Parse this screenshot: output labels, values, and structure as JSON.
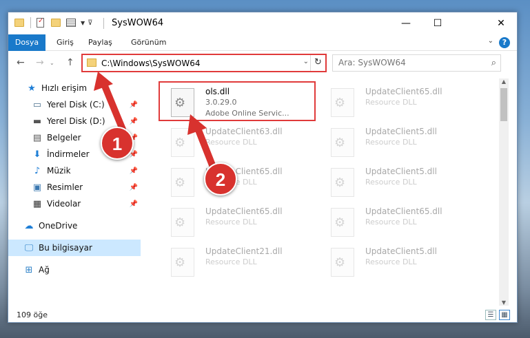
{
  "window": {
    "title": "SysWOW64",
    "controls": {
      "minimize": "—",
      "maximize": "☐",
      "close": "✕"
    }
  },
  "ribbon": {
    "tabs": [
      {
        "label": "Dosya"
      },
      {
        "label": "Giriş"
      },
      {
        "label": "Paylaş"
      },
      {
        "label": "Görünüm"
      }
    ],
    "help": "?"
  },
  "navigation": {
    "back": "←",
    "forward": "→",
    "up": "↑",
    "address": "C:\\Windows\\SysWOW64",
    "search_placeholder": "Ara: SysWOW64"
  },
  "sidebar": {
    "items": [
      {
        "label": "Hızlı erişim",
        "icon": "star-icon"
      },
      {
        "label": "Yerel Disk (C:)",
        "icon": "drive-icon"
      },
      {
        "label": "Yerel Disk (D:)",
        "icon": "drive-icon"
      },
      {
        "label": "Belgeler",
        "icon": "documents-icon"
      },
      {
        "label": "İndirmeler",
        "icon": "download-icon"
      },
      {
        "label": "Müzik",
        "icon": "music-icon"
      },
      {
        "label": "Resimler",
        "icon": "pictures-icon"
      },
      {
        "label": "Videolar",
        "icon": "video-icon"
      },
      {
        "label": "OneDrive",
        "icon": "cloud-icon"
      },
      {
        "label": "Bu bilgisayar",
        "icon": "computer-icon"
      },
      {
        "label": "Ağ",
        "icon": "network-icon"
      }
    ]
  },
  "files": [
    {
      "name": "ols.dll",
      "line1": "3.0.29.0",
      "line2": "Adobe Online Servic..."
    },
    {
      "name": "UpdateClient65.dll",
      "line1": "Resource DLL"
    },
    {
      "name": "UpdateClient63.dll",
      "line1": "Resource DLL"
    },
    {
      "name": "UpdateClient5.dll",
      "line1": "Resource DLL"
    },
    {
      "name": "UpdateClient65.dll",
      "line1": "Resource DLL"
    },
    {
      "name": "UpdateClient5.dll",
      "line1": "Resource DLL"
    },
    {
      "name": "UpdateClient65.dll",
      "line1": "Resource DLL"
    },
    {
      "name": "UpdateClient65.dll",
      "line1": "Resource DLL"
    },
    {
      "name": "UpdateClient21.dll",
      "line1": "Resource DLL"
    },
    {
      "name": "UpdateClient5.dll",
      "line1": "Resource DLL"
    }
  ],
  "status": {
    "item_count": "109 öğe"
  },
  "annotations": {
    "marker1": "1",
    "marker2": "2"
  },
  "colors": {
    "accent": "#1979ca",
    "highlight": "#e03a3a",
    "selected": "#cce8ff"
  }
}
